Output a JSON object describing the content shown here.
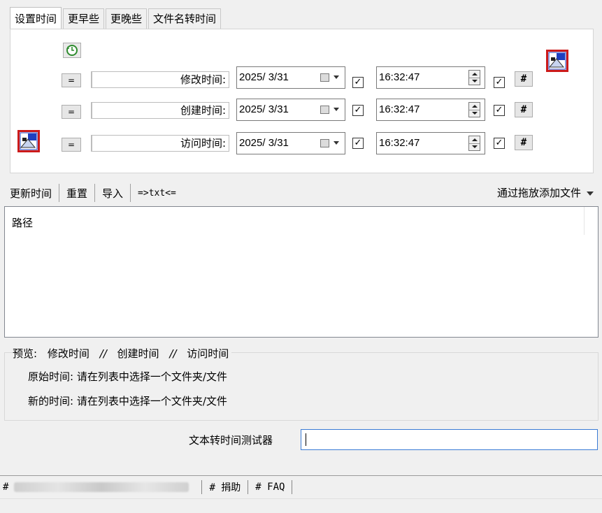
{
  "tabs": [
    "设置时间",
    "更早些",
    "更晚些",
    "文件名转时间"
  ],
  "equal_label": "=",
  "hash_label": "#",
  "check_mark": "✓",
  "rows": [
    {
      "label": "修改时间:",
      "date": "2025/ 3/31",
      "time": "16:32:47"
    },
    {
      "label": "创建时间:",
      "date": "2025/ 3/31",
      "time": "16:32:47"
    },
    {
      "label": "访问时间:",
      "date": "2025/ 3/31",
      "time": "16:32:47"
    }
  ],
  "toolbar": {
    "items": [
      "更新时间",
      "重置",
      "导入",
      "=>txt<="
    ],
    "drag_add": "通过拖放添加文件"
  },
  "list": {
    "column_header": "路径"
  },
  "preview": {
    "legend_prefix": "预览:",
    "modify": "修改时间",
    "sep": "//",
    "create": "创建时间",
    "access": "访问时间",
    "orig_label": "原始时间:",
    "orig_value": "请在列表中选择一个文件夹/文件",
    "new_label": "新的时间:",
    "new_value": "请在列表中选择一个文件夹/文件"
  },
  "tester": {
    "label": "文本转时间测试器",
    "value": ""
  },
  "status": {
    "first_prefix": "#",
    "donate": "# 捐助",
    "faq": "# FAQ"
  },
  "icons": {
    "refresh": "green-clock-refresh-icon",
    "apply": "calendar-grid-icon"
  },
  "colors": {
    "accent": "#3a7bd5",
    "icon_red": "#cc1a1a",
    "icon_blue": "#1e3fbf"
  }
}
